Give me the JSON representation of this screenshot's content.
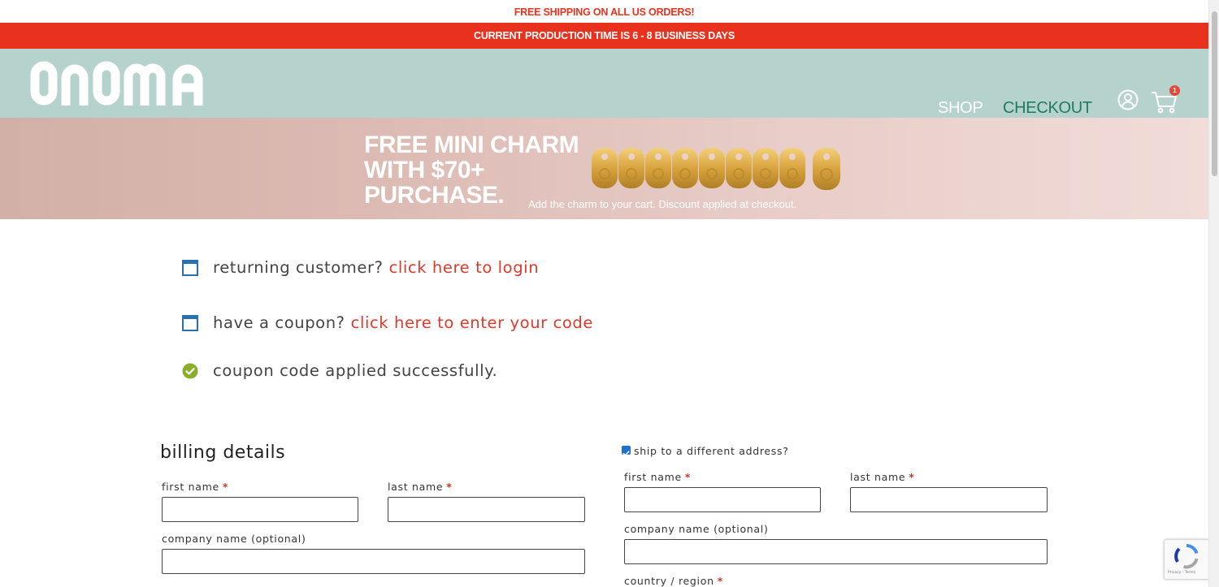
{
  "top_notice": "FREE SHIPPING ON ALL US ORDERS!",
  "production_notice": "CURRENT PRODUCTION TIME IS 6 - 8 BUSINESS DAYS",
  "header": {
    "logo_text": "onoma",
    "nav": {
      "shop": "SHOP",
      "checkout": "CHECKOUT"
    },
    "cart_count": "1"
  },
  "promo": {
    "title_lines": [
      "FREE MINI CHARM",
      "WITH $70+",
      "PURCHASE."
    ],
    "subtitle": "Add the charm to your cart. Discount applied at checkout."
  },
  "notices": {
    "returning_prefix": "returning customer?",
    "returning_link": "click here to login",
    "coupon_prefix": "have a coupon?",
    "coupon_link": "click here to enter your code",
    "coupon_success": "coupon code applied successfully."
  },
  "billing": {
    "title": "billing details",
    "first_name": "first name",
    "last_name": "last name",
    "company": "company name (optional)",
    "required_mark": "*"
  },
  "shipping": {
    "toggle_label": "ship to a different address?",
    "toggle_checked": true,
    "first_name": "first name",
    "last_name": "last name",
    "company": "company name (optional)",
    "country": "country / region",
    "required_mark": "*"
  },
  "recaptcha_text": "Privacy - Terms",
  "colors": {
    "accent_red": "#e8321e",
    "header_teal": "#b5d2cd",
    "checkout_green": "#1f7a62",
    "link_red": "#e0392b",
    "success_green": "#8aae2a",
    "notice_blue": "#2a6fb0"
  }
}
